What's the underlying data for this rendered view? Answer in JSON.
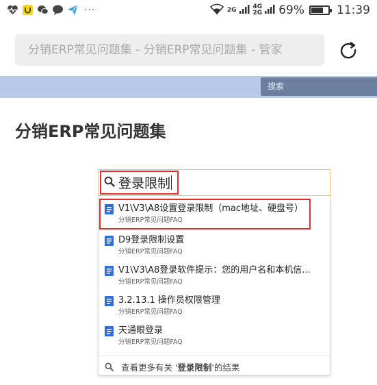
{
  "status_bar": {
    "left_icons": [
      "heart-pulse-icon",
      "app-badge-icon",
      "wechat-icon",
      "chat-bubble-icon",
      "send-plane-icon"
    ],
    "more_indicator": "···",
    "network_small_1": "2G",
    "network_small_2": "4G",
    "network_small_3": "2G",
    "battery_percent": "69%",
    "battery_level": 0.69,
    "time": "11:39"
  },
  "browser": {
    "url_title": "分销ERP常见问题集 - 分销ERP常见问题集 - 管家"
  },
  "site_header": {
    "search_placeholder": "搜索"
  },
  "page": {
    "title": "分销ERP常见问题集"
  },
  "search": {
    "query": "登录限制",
    "results": [
      {
        "title": "V1\\V3\\A8设置登录限制（mac地址、硬盘号）",
        "space": "分销ERP常见问题FAQ"
      },
      {
        "title": "D9登录限制设置",
        "space": "分销ERP常见问题FAQ"
      },
      {
        "title": "V1\\V3\\A8登录软件提示：您的用户名和本机信...",
        "space": "分销ERP常见问题FAQ"
      },
      {
        "title": "3.2.13.1 操作员权限管理",
        "space": "分销ERP常见问题FAQ"
      },
      {
        "title": "天通眼登录",
        "space": "分销ERP常见问题FAQ"
      }
    ],
    "more_prefix": "查看更多有关 '",
    "more_query": "登录限制",
    "more_suffix": "'的结果"
  },
  "colors": {
    "doc_icon": "#2f6fd8",
    "highlight_border": "#e03030",
    "header_bar": "#b9c9e8"
  }
}
